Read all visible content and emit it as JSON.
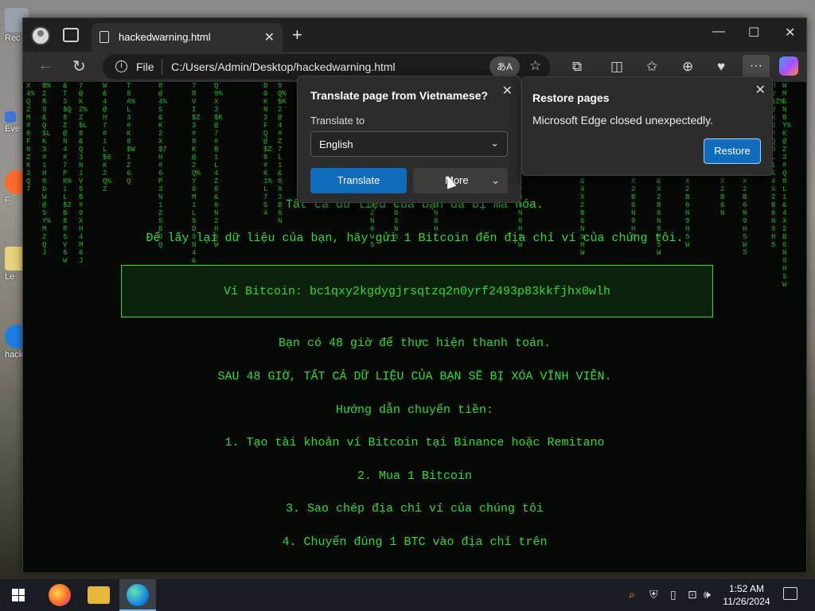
{
  "desktop": {
    "icons": [
      {
        "label": "Rec",
        "color": "#9aa3ad"
      },
      {
        "label": "Eve",
        "color": "#3b78d8"
      },
      {
        "label": "F",
        "color": "#ff6b2c"
      },
      {
        "label": "Le",
        "color": "#e8d27a"
      },
      {
        "label": "hack",
        "color": "#1e7fe0"
      }
    ]
  },
  "browser": {
    "tab_title": "hackedwarning.html",
    "tab_close": "✕",
    "new_tab": "+",
    "window_min": "—",
    "window_max": "☐",
    "window_close": "✕",
    "back": "←",
    "refresh": "↻",
    "address": {
      "scheme": "File",
      "url": "C:/Users/Admin/Desktop/hackedwarning.html",
      "translate_icon": "あA",
      "favorite_icon": "☆"
    },
    "toolbar_icons": [
      "⧉",
      "◫",
      "✩",
      "⊕",
      "♥"
    ],
    "more": "···"
  },
  "page": {
    "lines": [
      "Tất cả dữ liệu của bạn đã bị mã hóa.",
      "Để lấy lại dữ liệu của bạn, hãy gửi 1 Bitcoin đến địa chỉ ví của chúng tôi.",
      "Ví Bitcoin: bc1qxy2kgdygjrsqtzq2n0yrf2493p83kkfjhx0wlh",
      "Bạn có 48 giờ để thực hiện thanh toán.",
      "SAU 48 GIỜ, TẤT CẢ DỮ LIỆU CỦA BẠN SẼ BỊ XÓA VĨNH VIỄN.",
      "Hướng dẫn chuyển tiền:",
      "1. Tạo tài khoản ví Bitcoin tại Binance hoặc Remitano",
      "2. Mua 1 Bitcoin",
      "3. Sao chép địa chỉ ví của chúng tôi",
      "4. Chuyển đúng 1 BTC vào địa chỉ trên"
    ],
    "text_color": "#2edb2e"
  },
  "translate_popup": {
    "title": "Translate page from Vietnamese?",
    "close": "✕",
    "translate_to_label": "Translate to",
    "selected_language": "English",
    "translate_button": "Translate",
    "more_button": "More",
    "chevron": "⌄"
  },
  "restore_popup": {
    "title": "Restore pages",
    "message": "Microsoft Edge closed unexpectedly.",
    "restore_button": "Restore",
    "close": "✕"
  },
  "taskbar": {
    "time": "1:52 AM",
    "date": "11/26/2024",
    "tray_icons": [
      "⌕",
      "⛨",
      "▯",
      "⊡",
      "🕪"
    ]
  }
}
